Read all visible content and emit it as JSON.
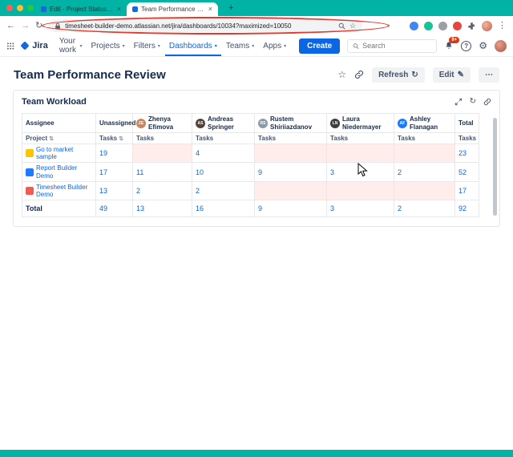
{
  "colors": {
    "frame_teal": "#00B3A4",
    "accent_blue": "#0C66E4",
    "empty_cell_pink": "#FFEDEB",
    "annotation_red": "#E5372B"
  },
  "icons": {
    "back": "←",
    "forward": "→",
    "reload": "↻",
    "new_tab": "+",
    "close": "×",
    "chevron_down": "▾",
    "sort": "⇅",
    "star": "☆",
    "more": "⋯",
    "pencil": "✎",
    "refresh": "↻",
    "gear": "⚙",
    "help": "?",
    "dots_vertical": "⋮"
  },
  "browser": {
    "tabs": [
      {
        "title": "Edit - Project Status Report"
      },
      {
        "title": "Team Performance Review"
      }
    ],
    "url": "timesheet-builder-demo.atlassian.net/jira/dashboards/10034?maximized=10050"
  },
  "topnav": {
    "logo": "Jira",
    "items": [
      "Your work",
      "Projects",
      "Filters",
      "Dashboards",
      "Teams",
      "Apps"
    ],
    "create": "Create",
    "search_placeholder": "Search",
    "notification_count": "9+"
  },
  "page": {
    "title": "Team Performance Review",
    "refresh": "Refresh",
    "edit": "Edit"
  },
  "gadget": {
    "title": "Team Workload",
    "table": {
      "assignee_header": "Assignee",
      "project_header": "Project",
      "tasks_header": "Tasks",
      "total_header": "Total",
      "total_row_label": "Total",
      "assignees": [
        {
          "name": "Unassigned"
        },
        {
          "name": "Zhenya Efimova",
          "initials": "ZE",
          "avatar_color": "#C9875F"
        },
        {
          "name": "Andreas Springer",
          "initials": "AS",
          "avatar_color": "#54433A"
        },
        {
          "name": "Rustem Shiriiazdanov",
          "initials": "RS",
          "avatar_color": "#8C9AA5"
        },
        {
          "name": "Laura Niedermayer",
          "initials": "LN",
          "avatar_color": "#3E3E42"
        },
        {
          "name": "Ashley Flanagan",
          "initials": "AF",
          "avatar_color": "#1D7AFC"
        }
      ],
      "rows": [
        {
          "project": "Go to market sample",
          "icon_color": "#FFC400",
          "values": [
            "19",
            "",
            "4",
            "",
            "",
            ""
          ],
          "total": "23"
        },
        {
          "project": "Report Builder Demo",
          "icon_color": "#1D7AFC",
          "values": [
            "17",
            "11",
            "10",
            "9",
            "3",
            "2"
          ],
          "total": "52"
        },
        {
          "project": "Timesheet Builder Demo",
          "icon_color": "#F15B50",
          "values": [
            "13",
            "2",
            "2",
            "",
            "",
            ""
          ],
          "total": "17"
        }
      ],
      "totals": {
        "values": [
          "49",
          "13",
          "16",
          "9",
          "3",
          "2"
        ],
        "total": "92"
      }
    }
  }
}
